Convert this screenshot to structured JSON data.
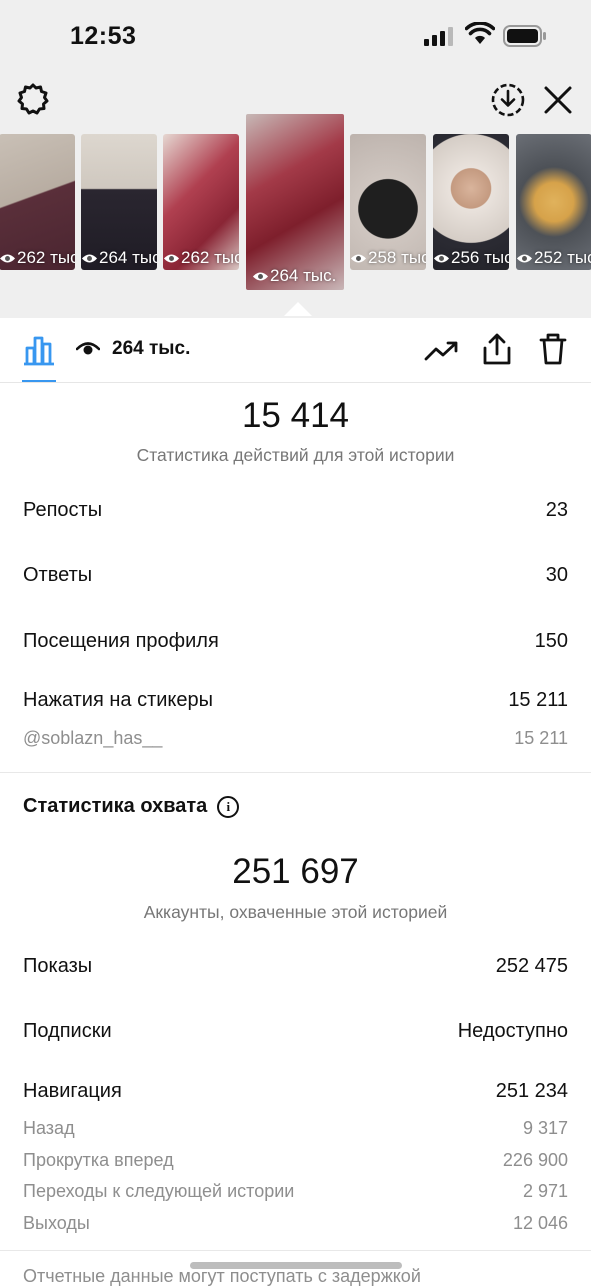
{
  "status_bar": {
    "time": "12:53"
  },
  "stories": [
    {
      "views": "262 тыс.",
      "colors": [
        "#c9c0b6",
        "#5a2f3a"
      ]
    },
    {
      "views": "264 тыс.",
      "colors": [
        "#d8d2ca",
        "#2a2630"
      ]
    },
    {
      "views": "262 тыс.",
      "colors": [
        "#e6d8d2",
        "#8a2535"
      ]
    },
    {
      "views": "264 тыс.",
      "colors": [
        "#c7b8b6",
        "#7e1f2c"
      ],
      "selected": true
    },
    {
      "views": "258 тыс.",
      "colors": [
        "#cfc6c0",
        "#1f1f1f"
      ]
    },
    {
      "views": "256 тыс.",
      "colors": [
        "#e9e2dc",
        "#2b2b33"
      ]
    },
    {
      "views": "252 тыс.",
      "colors": [
        "#6b6f76",
        "#d6a24a"
      ]
    }
  ],
  "toolbar": {
    "views_label": "264 тыс."
  },
  "actions": {
    "total": "15 414",
    "caption": "Статистика действий для этой истории",
    "rows": [
      {
        "label": "Репосты",
        "value": "23"
      },
      {
        "label": "Ответы",
        "value": "30"
      },
      {
        "label": "Посещения профиля",
        "value": "150"
      },
      {
        "label": "Нажатия на стикеры",
        "value": "15 211"
      }
    ],
    "sticker_sub": {
      "label": "@soblazn_has__",
      "value": "15 211"
    }
  },
  "reach": {
    "title": "Статистика охвата",
    "total": "251 697",
    "caption": "Аккаунты, охваченные этой историей",
    "impressions": {
      "label": "Показы",
      "value": "252 475"
    },
    "follows": {
      "label": "Подписки",
      "value": "Недоступно"
    },
    "navigation": {
      "label": "Навигация",
      "value": "251 234"
    },
    "nav_rows": [
      {
        "label": "Назад",
        "value": "9 317"
      },
      {
        "label": "Прокрутка вперед",
        "value": "226 900"
      },
      {
        "label": "Переходы к следующей истории",
        "value": "2 971"
      },
      {
        "label": "Выходы",
        "value": "12 046"
      }
    ]
  },
  "footer": {
    "note": "Отчетные данные могут поступать с задержкой"
  }
}
